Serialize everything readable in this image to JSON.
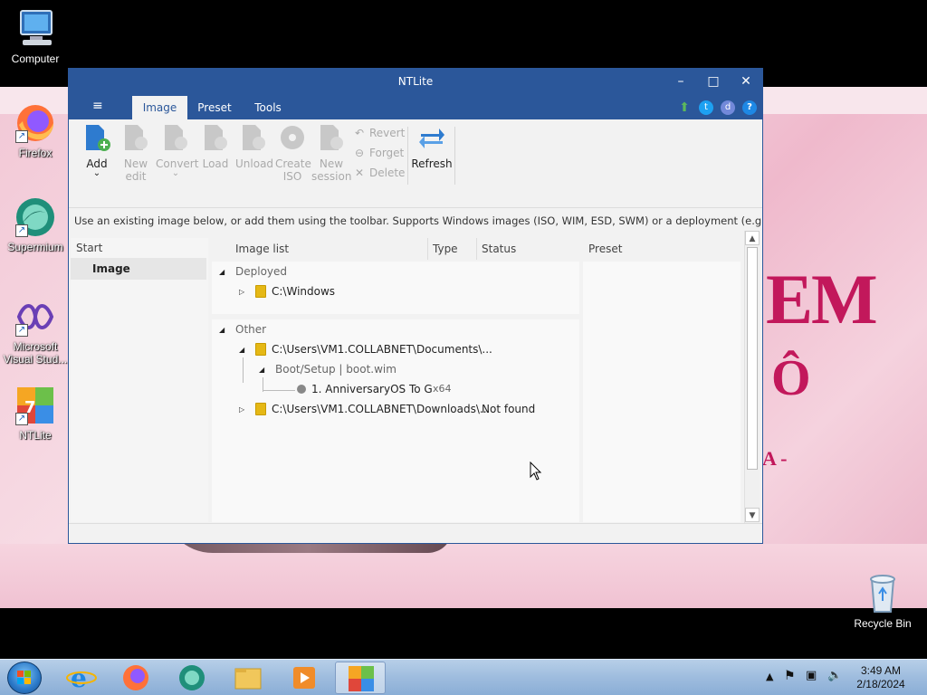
{
  "desktop": {
    "icons": [
      {
        "label": "Computer"
      },
      {
        "label": "Firefox"
      },
      {
        "label": "Supermium"
      },
      {
        "label_line1": "Microsoft",
        "label_line2": "Visual Stud..."
      },
      {
        "label": "NTLite"
      },
      {
        "label": "Recycle Bin"
      }
    ],
    "wallpaper_text": {
      "big": "EM",
      "mid": "Ô",
      "small": "A -"
    }
  },
  "window": {
    "title": "NTLite",
    "controls": {
      "minimize": "–",
      "maximize": "□",
      "close": "✕"
    },
    "menu_icon": "≡",
    "tabs": [
      {
        "label": "Image",
        "active": true
      },
      {
        "label": "Preset",
        "active": false
      },
      {
        "label": "Tools",
        "active": false
      }
    ],
    "toolbar": {
      "add": {
        "line1": "Add",
        "line2": "⌄"
      },
      "new_edit": {
        "line1": "New",
        "line2": "edit"
      },
      "convert": {
        "line1": "Convert",
        "line2": "⌄"
      },
      "load": {
        "line1": "Load"
      },
      "unload": {
        "line1": "Unload"
      },
      "create_iso": {
        "line1": "Create",
        "line2": "ISO"
      },
      "new_session": {
        "line1": "New",
        "line2": "session"
      },
      "revert": "Revert",
      "forget": "Forget",
      "delete": "Delete",
      "refresh": "Refresh"
    },
    "info_text": "Use an existing image below, or add them using the toolbar. Supports Windows images (ISO, WIM, ESD, SWM) or a deployment (e.g. C:\\Wind...",
    "start_panel": {
      "header": "Start",
      "item": "Image"
    },
    "image_list": {
      "headers": {
        "name": "Image list",
        "type": "Type",
        "status": "Status"
      },
      "deployed": {
        "label": "Deployed",
        "items": [
          {
            "name": "C:\\Windows"
          }
        ]
      },
      "other": {
        "label": "Other",
        "items": [
          {
            "name": "C:\\Users\\VM1.COLLABNET\\Documents\\..."
          },
          {
            "name": "Boot/Setup  |  boot.wim"
          },
          {
            "name": "1. AnniversaryOS To G...",
            "type": "x64"
          },
          {
            "name": "C:\\Users\\VM1.COLLABNET\\Downloads\\...",
            "status": "Not found"
          }
        ]
      }
    },
    "preset_panel": {
      "header": "Preset"
    }
  },
  "taskbar": {
    "clock": {
      "time": "3:49 AM",
      "date": "2/18/2024"
    },
    "tray_chevron": "▲"
  },
  "colors": {
    "titlebar": "#2b579a",
    "folder": "#e5b815",
    "wallpaper_pink": "#f2c8d6",
    "accent_text": "#c2185b"
  }
}
